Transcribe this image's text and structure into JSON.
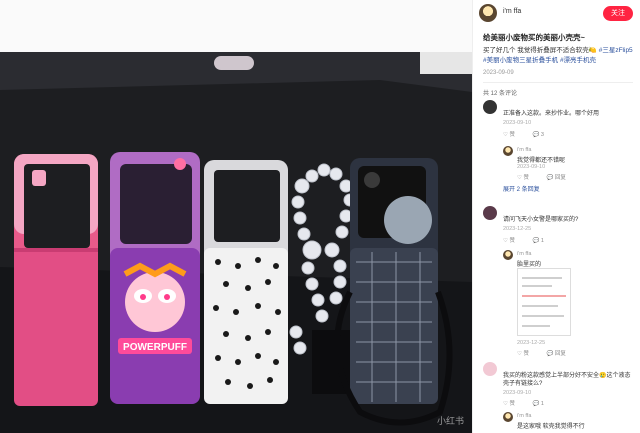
{
  "author": {
    "name": "i'm ffa",
    "follow_label": "关注"
  },
  "post": {
    "title": "给美丽小废物买的美丽小壳壳~",
    "body_text": "买了好几个 我觉得折叠屏不适合软壳🍋",
    "tags": [
      "#三星zFlip5",
      "#美丽小废物三星折叠手机",
      "#漂亮手机壳"
    ],
    "date": "2023-09-09",
    "comment_count": "共 12 条评论"
  },
  "photo": {
    "watermark": "小红书"
  },
  "comments": [
    {
      "name": "",
      "text": "正准备入这款。来抄作业。哪个好用",
      "date": "2023-09-10",
      "likes": "赞",
      "replies": "3",
      "reply": {
        "name": "i'm ffa",
        "text": "我觉得都还不错呢",
        "date": "2023-09-10",
        "likes": "赞",
        "reply_label": "回复"
      },
      "expand_label": "展开 2 条回复"
    },
    {
      "name": "",
      "text": "请问飞天小女警是哪家买的?",
      "date": "2023-12-25",
      "likes": "赞",
      "replies": "1",
      "reply": {
        "name": "i'm ffa",
        "text": "胎里买的",
        "date": "2023-12-25",
        "likes": "赞",
        "reply_label": "回复"
      }
    },
    {
      "name": "",
      "text": "我买的粉这款感觉上半部分好不安全🥲这个液态壳子有链接么?",
      "date": "2023-09-10",
      "likes": "赞",
      "replies": "1",
      "reply": {
        "name": "i'm ffa",
        "text": "是这家哦 软壳我觉得不行"
      }
    }
  ],
  "colors": {
    "accent": "#ff2442",
    "tag": "#2a4f9c"
  }
}
